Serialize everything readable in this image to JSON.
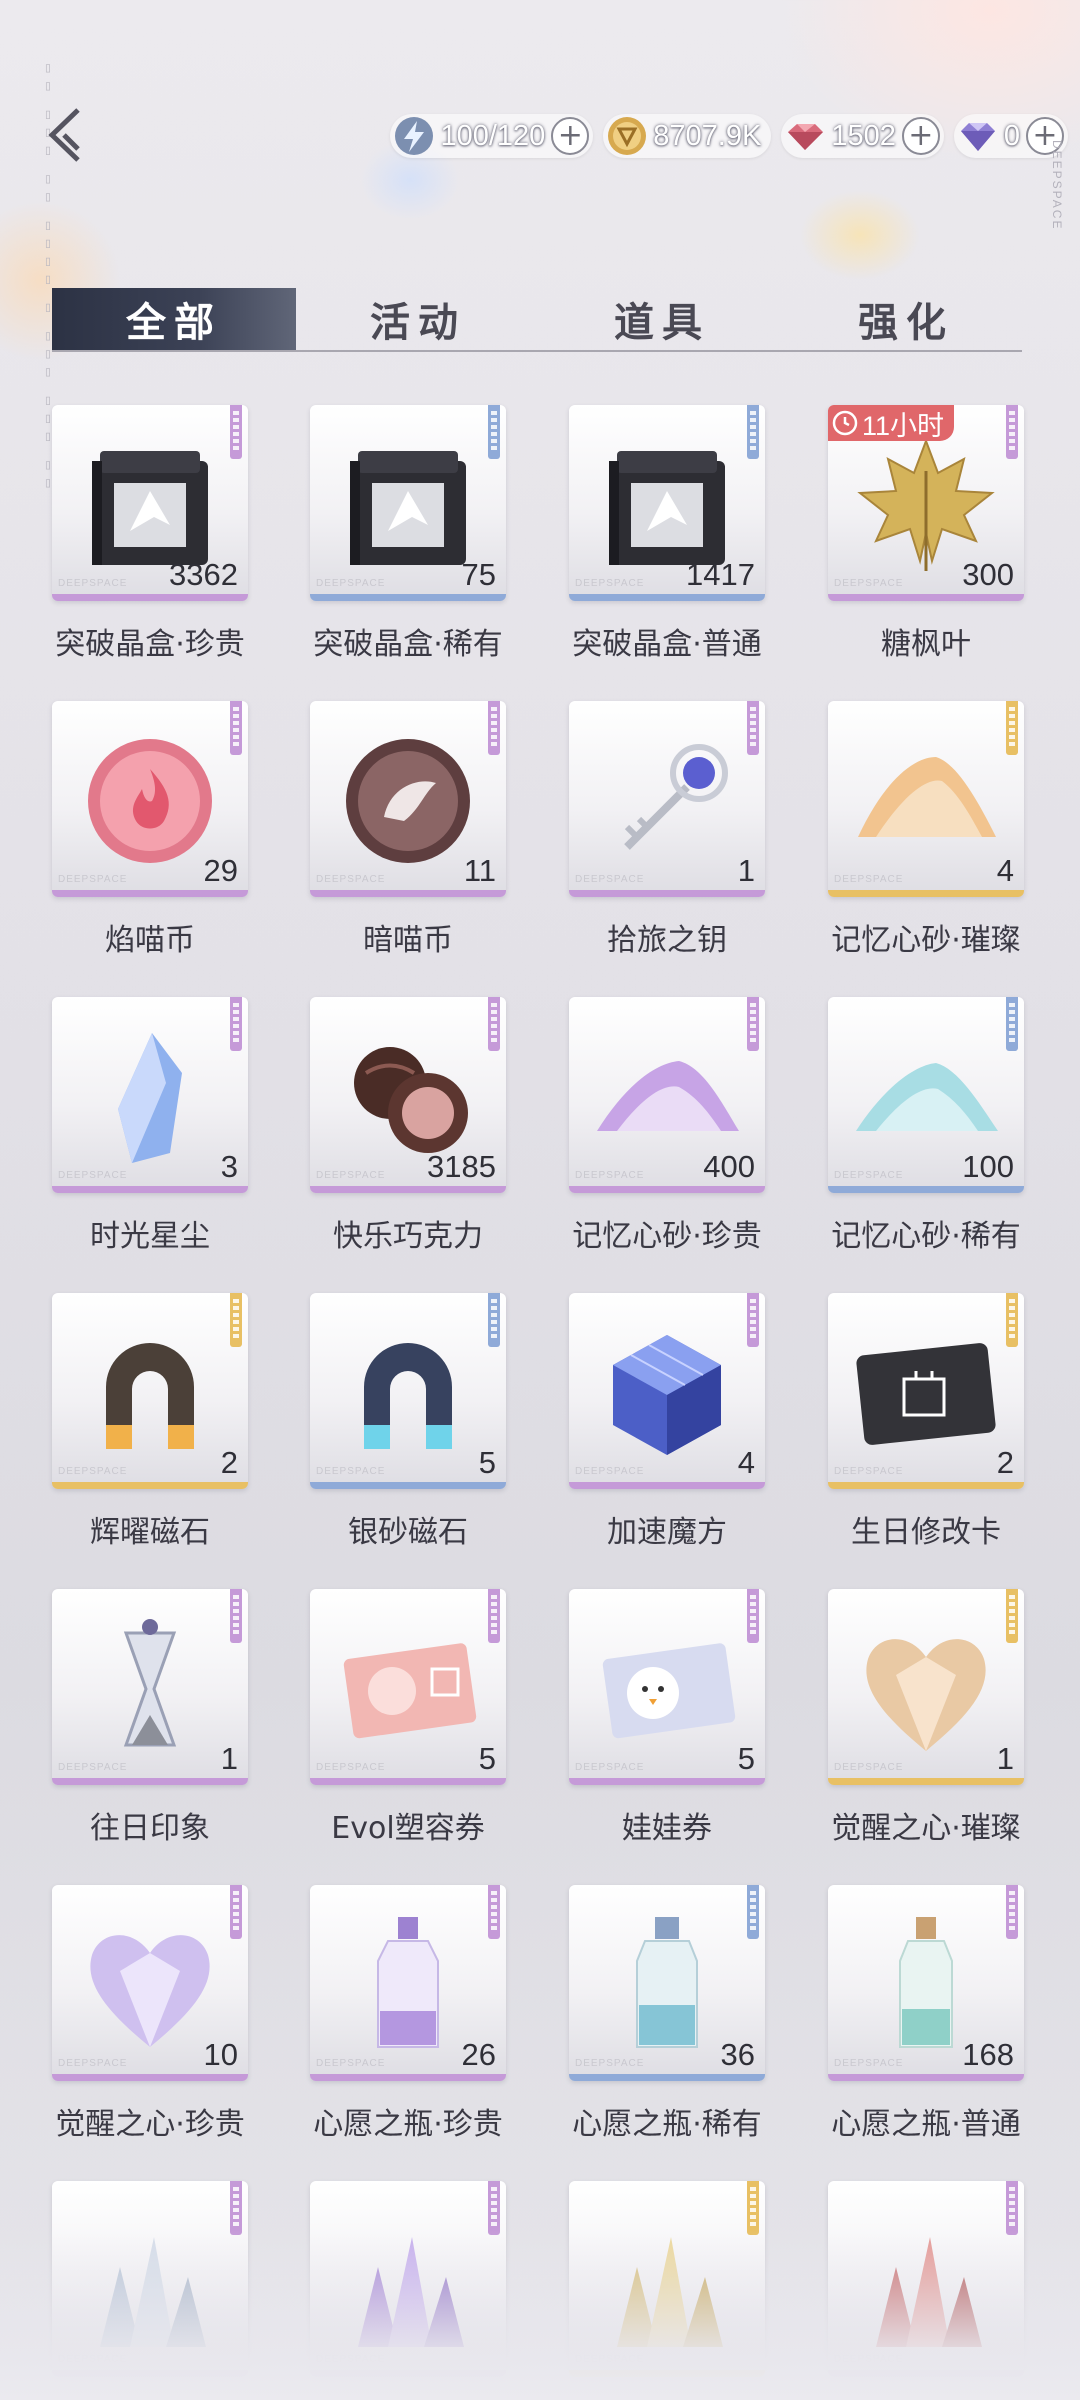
{
  "resources": [
    {
      "icon": "energy-icon",
      "value": "100/120",
      "has_plus": true
    },
    {
      "icon": "gold-coin-icon",
      "value": "8707.9K",
      "has_plus": false
    },
    {
      "icon": "red-gem-icon",
      "value": "1502",
      "has_plus": true
    },
    {
      "icon": "purple-diamond-icon",
      "value": "0",
      "has_plus": true
    }
  ],
  "brand_vertical": "DEEPSPACE",
  "tabs": [
    {
      "label": "全部",
      "active": true
    },
    {
      "label": "活动",
      "active": false
    },
    {
      "label": "道具",
      "active": false
    },
    {
      "label": "强化",
      "active": false
    }
  ],
  "card_watermark": "DEEPSPACE",
  "rarity_colors": {
    "purple": "#c59ad8",
    "blue": "#8faad8",
    "gold": "#e8c064"
  },
  "items": [
    {
      "name": "突破晶盒·珍贵",
      "count": "3362",
      "rarity": "purple",
      "icon": "black-crystal-box-icon"
    },
    {
      "name": "突破晶盒·稀有",
      "count": "75",
      "rarity": "blue",
      "icon": "black-crystal-box-icon"
    },
    {
      "name": "突破晶盒·普通",
      "count": "1417",
      "rarity": "blue",
      "icon": "black-crystal-box-icon"
    },
    {
      "name": "糖枫叶",
      "count": "300",
      "rarity": "purple",
      "icon": "maple-leaf-icon",
      "timer": "11小时"
    },
    {
      "name": "焰喵币",
      "count": "29",
      "rarity": "purple",
      "icon": "flame-cat-coin-icon"
    },
    {
      "name": "暗喵币",
      "count": "11",
      "rarity": "purple",
      "icon": "dark-cat-coin-icon"
    },
    {
      "name": "拾旅之钥",
      "count": "1",
      "rarity": "purple",
      "icon": "key-icon"
    },
    {
      "name": "记忆心砂·璀璨",
      "count": "4",
      "rarity": "gold",
      "icon": "golden-sand-pile-icon"
    },
    {
      "name": "时光星尘",
      "count": "3",
      "rarity": "purple",
      "icon": "blue-crystal-icon"
    },
    {
      "name": "快乐巧克力",
      "count": "3185",
      "rarity": "purple",
      "icon": "chocolate-icon"
    },
    {
      "name": "记忆心砂·珍贵",
      "count": "400",
      "rarity": "purple",
      "icon": "purple-sand-pile-icon"
    },
    {
      "name": "记忆心砂·稀有",
      "count": "100",
      "rarity": "blue",
      "icon": "blue-sand-pile-icon"
    },
    {
      "name": "辉曜磁石",
      "count": "2",
      "rarity": "gold",
      "icon": "gold-magnet-icon"
    },
    {
      "name": "银砂磁石",
      "count": "5",
      "rarity": "blue",
      "icon": "blue-magnet-icon"
    },
    {
      "name": "加速魔方",
      "count": "4",
      "rarity": "purple",
      "icon": "cube-icon"
    },
    {
      "name": "生日修改卡",
      "count": "2",
      "rarity": "gold",
      "icon": "birthday-card-icon"
    },
    {
      "name": "往日印象",
      "count": "1",
      "rarity": "purple",
      "icon": "hourglass-icon"
    },
    {
      "name": "Evol塑容券",
      "count": "5",
      "rarity": "purple",
      "icon": "pink-ticket-icon"
    },
    {
      "name": "娃娃券",
      "count": "5",
      "rarity": "purple",
      "icon": "doll-ticket-icon"
    },
    {
      "name": "觉醒之心·璀璨",
      "count": "1",
      "rarity": "gold",
      "icon": "gold-heart-gem-icon"
    },
    {
      "name": "觉醒之心·珍贵",
      "count": "10",
      "rarity": "purple",
      "icon": "purple-heart-gem-icon"
    },
    {
      "name": "心愿之瓶·珍贵",
      "count": "26",
      "rarity": "purple",
      "icon": "purple-bottle-icon"
    },
    {
      "name": "心愿之瓶·稀有",
      "count": "36",
      "rarity": "blue",
      "icon": "blue-bottle-icon"
    },
    {
      "name": "心愿之瓶·普通",
      "count": "168",
      "rarity": "purple",
      "icon": "green-bottle-icon"
    },
    {
      "name": "",
      "count": "",
      "rarity": "purple",
      "icon": "silver-crystal-cluster-icon"
    },
    {
      "name": "",
      "count": "",
      "rarity": "purple",
      "icon": "purple-crystal-cluster-icon"
    },
    {
      "name": "",
      "count": "",
      "rarity": "gold",
      "icon": "gold-crystal-cluster-icon"
    },
    {
      "name": "",
      "count": "",
      "rarity": "purple",
      "icon": "red-crystal-cluster-icon"
    }
  ]
}
